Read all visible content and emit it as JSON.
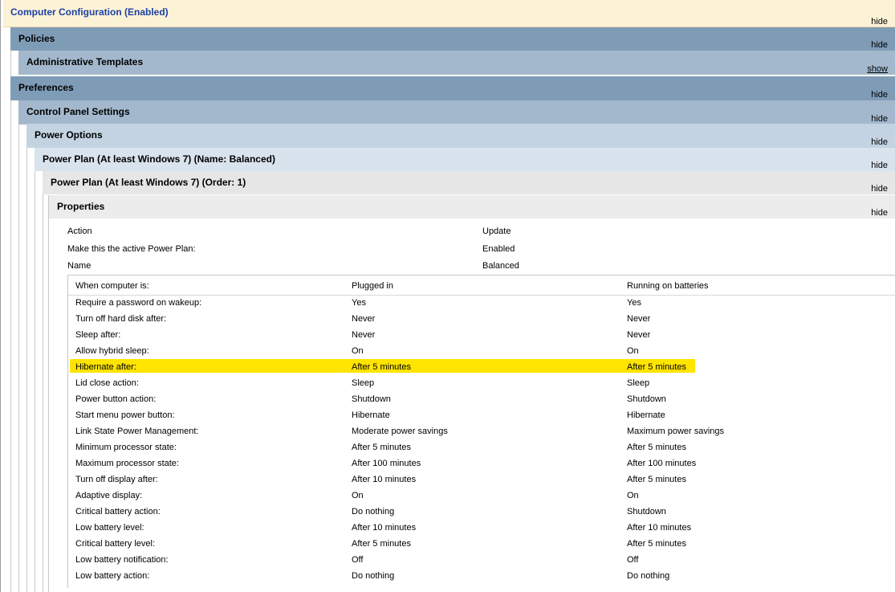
{
  "highlight_color": "#ffe400",
  "sections": [
    {
      "title": "Computer Configuration (Enabled)",
      "toggle": "hide"
    },
    {
      "title": "Policies",
      "toggle": "hide"
    },
    {
      "title": "Administrative Templates",
      "toggle": "show"
    },
    {
      "title": "Preferences",
      "toggle": "hide"
    },
    {
      "title": "Control Panel Settings",
      "toggle": "hide"
    },
    {
      "title": "Power Options",
      "toggle": "hide"
    },
    {
      "title": "Power Plan (At least Windows 7) (Name: Balanced)",
      "toggle": "hide"
    },
    {
      "title": "Power Plan (At least Windows 7) (Order: 1)",
      "toggle": "hide"
    },
    {
      "title": "Properties",
      "toggle": "hide"
    }
  ],
  "properties": [
    {
      "label": "Action",
      "value": "Update"
    },
    {
      "label": "Make this the active Power Plan:",
      "value": "Enabled"
    },
    {
      "label": "Name",
      "value": "Balanced"
    }
  ],
  "table": {
    "headers": [
      "When computer is:",
      "Plugged in",
      "Running on batteries"
    ],
    "rows": [
      [
        "Require a password on wakeup:",
        "Yes",
        "Yes"
      ],
      [
        "Turn off hard disk after:",
        "Never",
        "Never"
      ],
      [
        "Sleep after:",
        "Never",
        "Never"
      ],
      [
        "Allow hybrid sleep:",
        "On",
        "On"
      ],
      [
        "Hibernate after:",
        "After 5 minutes",
        "After 5 minutes"
      ],
      [
        "Lid close action:",
        "Sleep",
        "Sleep"
      ],
      [
        "Power button action:",
        "Shutdown",
        "Shutdown"
      ],
      [
        "Start menu power button:",
        "Hibernate",
        "Hibernate"
      ],
      [
        "Link State Power Management:",
        "Moderate power savings",
        "Maximum power savings"
      ],
      [
        "Minimum processor state:",
        "After 5 minutes",
        "After 5 minutes"
      ],
      [
        "Maximum processor state:",
        "After 100 minutes",
        "After 100 minutes"
      ],
      [
        "Turn off display after:",
        "After 10 minutes",
        "After 5 minutes"
      ],
      [
        "Adaptive display:",
        "On",
        "On"
      ],
      [
        "Critical battery action:",
        "Do nothing",
        "Shutdown"
      ],
      [
        "Low battery level:",
        "After 10 minutes",
        "After 10 minutes"
      ],
      [
        "Critical battery level:",
        "After 5 minutes",
        "After 5 minutes"
      ],
      [
        "Low battery notification:",
        "Off",
        "Off"
      ],
      [
        "Low battery action:",
        "Do nothing",
        "Do nothing"
      ]
    ],
    "highlighted_row": 4
  }
}
